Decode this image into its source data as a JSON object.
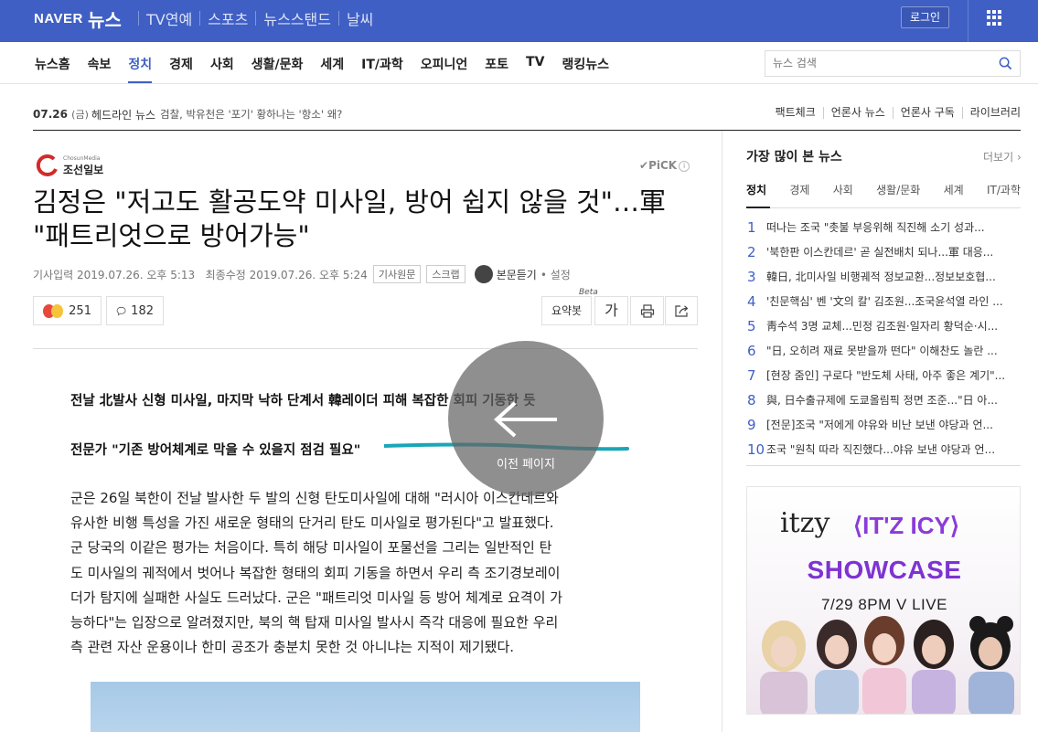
{
  "brand": {
    "naver": "NAVER",
    "news": "뉴스"
  },
  "top_nav": [
    "TV연예",
    "스포츠",
    "뉴스스탠드",
    "날씨"
  ],
  "login_label": "로그인",
  "categories": [
    "뉴스홈",
    "속보",
    "정치",
    "경제",
    "사회",
    "생활/문화",
    "세계",
    "IT/과학",
    "오피니언",
    "포토",
    "TV",
    "랭킹뉴스"
  ],
  "active_category": "정치",
  "search": {
    "placeholder": "뉴스 검색"
  },
  "headline_bar": {
    "date": "07.26",
    "day": "(금)",
    "label": "헤드라인 뉴스",
    "text": "검찰, 박유천은 '포기' 황하나는 '항소' 왜?",
    "links": [
      "팩트체크",
      "언론사 뉴스",
      "언론사 구독",
      "라이브러리"
    ]
  },
  "article": {
    "press_small": "ChosunMedia",
    "press": "조선일보",
    "pick": "PiCK",
    "title_line1": "김정은 \"저고도 활공도약 미사일, 방어 쉽지 않을 것\"…軍",
    "title_line2": "\"패트리엇으로 방어가능\"",
    "input_label": "기사입력",
    "input_time": "2019.07.26. 오후 5:13",
    "modified_label": "최종수정",
    "modified_time": "2019.07.26. 오후 5:24",
    "original_btn": "기사원문",
    "scrap_btn": "스크랩",
    "listen_btn": "본문듣기",
    "settings": "설정",
    "reaction_count": "251",
    "comment_count": "182",
    "summary_btn": "요약봇",
    "beta": "Beta",
    "font_btn": "가",
    "subtitle1": "전날 北발사 신형 미사일, 마지막 낙하 단계서 韓레이더 피해 복잡한 회피 기동한 듯",
    "subtitle2": "전문가 \"기존 방어체계로 막을 수 있을지 점검 필요\"",
    "body_lines": [
      "군은 26일 북한이 전날 발사한 두 발의 신형 탄도미사일에 대해 \"러시아 이스칸데르와",
      "유사한 비행 특성을 가진 새로운 형태의 단거리 탄도 미사일로 평가된다\"고 발표했다.",
      "군 당국의 이같은 평가는 처음이다. 특히 해당 미사일이 포물선을 그리는 일반적인 탄",
      "도 미사일의 궤적에서 벗어나 복잡한 형태의 회피 기동을 하면서 우리 측 조기경보레이",
      "더가 탐지에 실패한 사실도 드러났다. 군은 \"패트리엇 미사일 등 방어 체계로 요격이 가",
      "능하다\"는 입장으로 알려졌지만, 북의 핵 탑재 미사일 발사시 즉각 대응에 필요한 우리",
      "측 관련 자산 운용이나 한미 공조가 충분치 못한 것 아니냐는 지적이 제기됐다."
    ]
  },
  "back_overlay": {
    "label": "이전 페이지"
  },
  "ranking": {
    "title": "가장 많이 본 뉴스",
    "more": "더보기",
    "tabs": [
      "정치",
      "경제",
      "사회",
      "생활/문화",
      "세계",
      "IT/과학"
    ],
    "active_tab": "정치",
    "items": [
      {
        "num": "1",
        "title": "떠나는 조국 \"촛불 부응위해 직진해 소기 성과..."
      },
      {
        "num": "2",
        "title": "'북한판 이스칸데르' 곧 실전배치 되나...軍 대응..."
      },
      {
        "num": "3",
        "title": "韓日, 北미사일 비행궤적 정보교환...정보보호협..."
      },
      {
        "num": "4",
        "title": "'친문핵심' 벤 '文의 칼' 김조원...조국윤석열 라인 ..."
      },
      {
        "num": "5",
        "title": "靑수석 3명 교체...민정 김조원·일자리 황덕순·시..."
      },
      {
        "num": "6",
        "title": "\"日, 오히려 재료 못받을까 떤다\" 이해찬도 놀란 ..."
      },
      {
        "num": "7",
        "title": "[현장 줌인] 구로다 \"반도체 사태, 아주 좋은 계기\"..."
      },
      {
        "num": "8",
        "title": "與, 日수출규제에 도쿄올림픽 정면 조준...\"日 아..."
      },
      {
        "num": "9",
        "title": "[전문]조국 \"저에게 야유와 비난 보낸 야당과 언..."
      },
      {
        "num": "10",
        "title": "조국 \"원칙 따라 직진했다...야유 보낸 야당과 언..."
      }
    ]
  },
  "ad": {
    "brand": "itzy",
    "brand2": "⟨IT'Z ICY⟩",
    "title": "SHOWCASE",
    "date": "7/29 8PM V LIVE"
  },
  "colors": {
    "naver_blue": "#3f5fc5",
    "ad_purple": "#7e33d3"
  }
}
